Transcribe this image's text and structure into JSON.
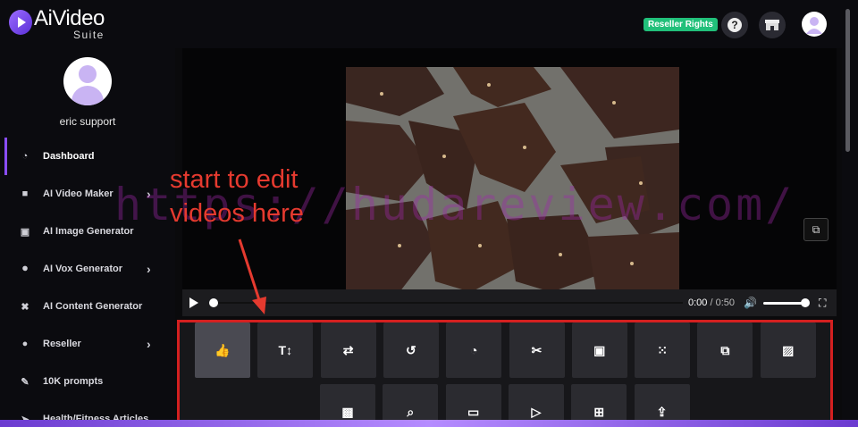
{
  "app": {
    "logo_text": "AiVideo",
    "logo_sub": "Suite",
    "badge": "Reseller Rights",
    "help_glyph": "?"
  },
  "sidebar": {
    "user_name": "eric support",
    "items": [
      {
        "label": "Dashboard",
        "icon": "gauge-icon",
        "active": true,
        "chevron": false
      },
      {
        "label": "AI Video Maker",
        "icon": "video-icon",
        "chevron": true
      },
      {
        "label": "AI Image Generator",
        "icon": "image-icon",
        "chevron": false
      },
      {
        "label": "AI Vox Generator",
        "icon": "microphone-icon",
        "chevron": true
      },
      {
        "label": "AI Content Generator",
        "icon": "tools-icon",
        "chevron": false
      },
      {
        "label": "Reseller",
        "icon": "users-icon",
        "chevron": true
      },
      {
        "label": "10K prompts",
        "icon": "pencil-icon",
        "chevron": false
      },
      {
        "label": "Health/Fitness Articles",
        "icon": "send-icon",
        "chevron": false
      }
    ]
  },
  "player": {
    "time_current": "0:00",
    "time_sep": " / ",
    "time_total": "0:50",
    "progress": 0,
    "volume": 0.95
  },
  "tools": {
    "row1": [
      "thumbs-up-icon",
      "text-size-icon",
      "swap-icon",
      "undo-icon",
      "speed-icon",
      "scissors-icon",
      "images-icon",
      "grid-icon",
      "overlay-icon",
      "picture-icon"
    ],
    "row2": [
      "photo-sticker-icon",
      "file-search-icon",
      "image-small-icon",
      "video-camera-icon",
      "file-add-icon",
      "upload-icon"
    ],
    "glyphs": {
      "thumbs-up-icon": "👍",
      "text-size-icon": "T↕",
      "swap-icon": "⇄",
      "undo-icon": "↺",
      "speed-icon": "◔",
      "scissors-icon": "✂",
      "images-icon": "▣",
      "grid-icon": "⁙",
      "overlay-icon": "⧉",
      "picture-icon": "▨",
      "photo-sticker-icon": "▩",
      "file-search-icon": "⌕",
      "image-small-icon": "▭",
      "video-camera-icon": "▷",
      "file-add-icon": "⊞",
      "upload-icon": "⇪"
    }
  },
  "annotation": {
    "line1": "start to edit",
    "line2": "videos here"
  },
  "watermark": "https://hudareview.com/",
  "colors": {
    "accent": "#8a4dff",
    "badge": "#21c07a",
    "annotation": "#e53a2f",
    "highlight_border": "#d42020"
  }
}
